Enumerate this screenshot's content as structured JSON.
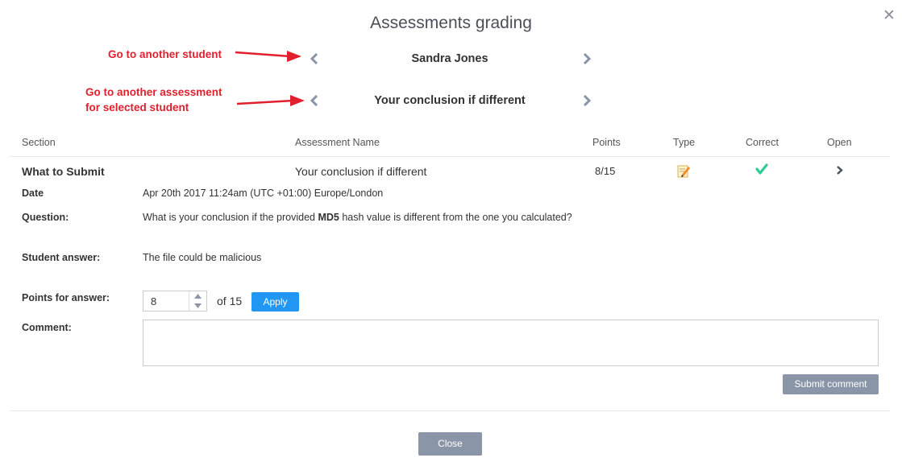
{
  "dialog": {
    "title": "Assessments grading",
    "close_icon": "close-icon"
  },
  "annotations": {
    "student_nav": "Go to another student",
    "assessment_nav_line1": "Go to another assessment",
    "assessment_nav_line2": "for selected student",
    "arrow_color": "#e0202e"
  },
  "navigation": {
    "student_name": "Sandra Jones",
    "assessment_name": "Your conclusion if different"
  },
  "table": {
    "headers": [
      "Section",
      "Assessment Name",
      "Points",
      "Type",
      "Correct",
      "Open"
    ],
    "row": {
      "section": "What to Submit",
      "assessment_name": "Your conclusion if different",
      "points": "8/15",
      "type_icon": "pencil-note-icon",
      "correct_icon": "checkmark-icon",
      "open_icon": "chevron-right-icon"
    }
  },
  "details": {
    "date_label": "Date",
    "date_value": "Apr 20th 2017 11:24am (UTC +01:00) Europe/London",
    "question_label": "Question:",
    "question_before": "What is your conclusion if the provided ",
    "question_bold": "MD5",
    "question_after": " hash value is different from the one you calculated?",
    "answer_label": "Student answer:",
    "answer_value": "The file could be malicious",
    "points_label": "Points for answer:",
    "points_value": "8",
    "points_of": "of 15",
    "apply_label": "Apply",
    "comment_label": "Comment:",
    "comment_value": "",
    "submit_comment_label": "Submit comment"
  },
  "footer": {
    "close_label": "Close"
  },
  "colors": {
    "accent_blue": "#2196f3",
    "button_gray": "#8a95a8",
    "correct_green": "#2ecc9a",
    "annotation_red": "#e0202e"
  }
}
